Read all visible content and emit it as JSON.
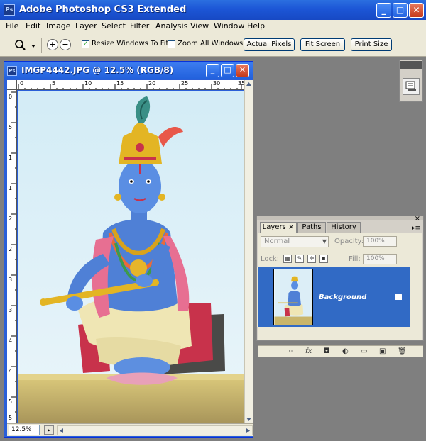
{
  "app": {
    "title": "Adobe Photoshop CS3 Extended",
    "icon_label": "Ps",
    "controls": {
      "minimize": "_",
      "maximize": "□",
      "close": "✕"
    }
  },
  "menu": [
    "File",
    "Edit",
    "Image",
    "Layer",
    "Select",
    "Filter",
    "Analysis",
    "View",
    "Window",
    "Help"
  ],
  "options_bar": {
    "zoom_in": "+",
    "zoom_out": "−",
    "resize_windows": {
      "label": "Resize Windows To Fit",
      "checked": true,
      "mark": "✓"
    },
    "zoom_all_windows": {
      "label": "Zoom All Windows",
      "checked": false
    },
    "buttons": {
      "actual_pixels": "Actual Pixels",
      "fit_screen": "Fit Screen",
      "print_size": "Print Size"
    }
  },
  "document": {
    "title": "IMGP4442.JPG @ 12.5% (RGB/8)",
    "icon_label": "Ps",
    "ruler_top": [
      "0",
      "5",
      "10",
      "15",
      "20",
      "25",
      "30",
      "35"
    ],
    "ruler_left": [
      "0",
      "5",
      "1",
      "1",
      "2",
      "2",
      "3",
      "3",
      "4",
      "4",
      "5",
      "5"
    ],
    "zoom": "12.5%"
  },
  "layers_panel": {
    "tabs": {
      "layers": "Layers ×",
      "paths": "Paths",
      "history": "History"
    },
    "close": "×",
    "menu": "▸≡",
    "blend_mode": "Normal",
    "opacity_label": "Opacity:",
    "opacity": "100%",
    "lock_label": "Lock:",
    "fill_label": "Fill:",
    "fill": "100%",
    "layer": {
      "name": "Background",
      "visible_icon": "◉"
    },
    "footer_icons": [
      "∞",
      "fx",
      "◘",
      "◐",
      "▭",
      "▣",
      "🗑"
    ]
  },
  "colors": {
    "xp_blue": "#2160dc",
    "selection": "#316ac5",
    "panel": "#ece9d8",
    "workspace": "#7f7f7f"
  }
}
